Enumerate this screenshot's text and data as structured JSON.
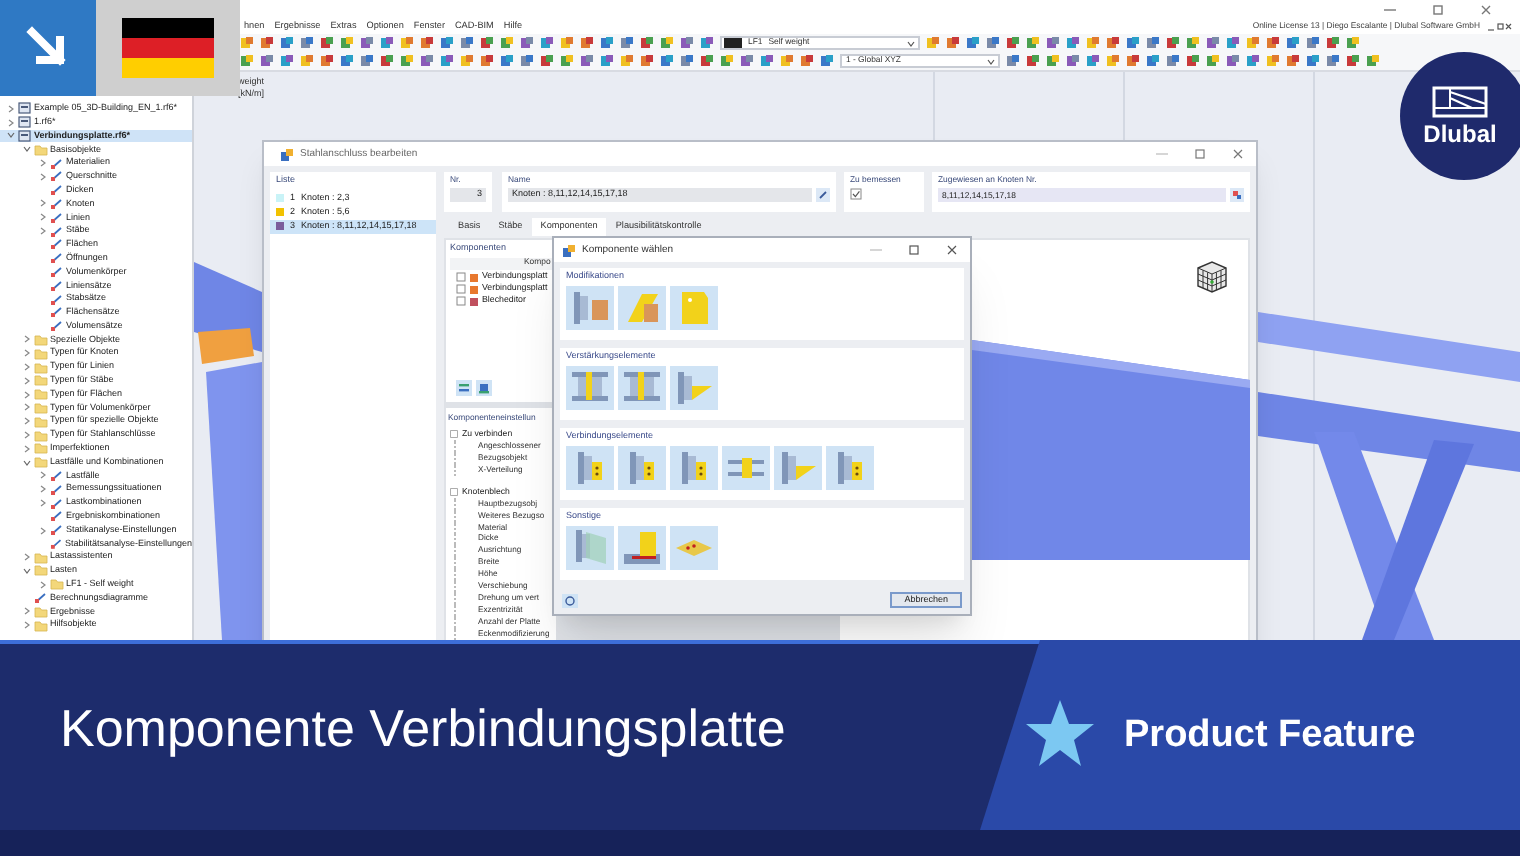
{
  "app": {
    "menu": [
      "hnen",
      "Ergebnisse",
      "Extras",
      "Optionen",
      "Fenster",
      "CAD-BIM",
      "Hilfe"
    ],
    "license": "Online License 13 | Diego Escalante | Dlubal Software GmbH",
    "load_case": {
      "code": "LF1",
      "name": "Self weight"
    },
    "coordinate_system": "1 - Global XYZ",
    "viewport_labels": [
      "weight",
      "[kN/m]"
    ]
  },
  "navigator": {
    "items": [
      {
        "kind": "file",
        "label": "Example 05_3D-Building_EN_1.rf6*",
        "selected": false,
        "expanded": false
      },
      {
        "kind": "file",
        "label": "1.rf6*",
        "selected": false,
        "expanded": false
      },
      {
        "kind": "file",
        "label": "Verbindungsplatte.rf6*",
        "selected": true,
        "expanded": true,
        "children": [
          {
            "kind": "folder",
            "label": "Basisobjekte",
            "expanded": true,
            "children": [
              {
                "kind": "object",
                "label": "Materialien",
                "expanded": false
              },
              {
                "kind": "object",
                "label": "Querschnitte",
                "expanded": false
              },
              {
                "kind": "object",
                "label": "Dicken"
              },
              {
                "kind": "object",
                "label": "Knoten",
                "expanded": false
              },
              {
                "kind": "object",
                "label": "Linien",
                "expanded": false
              },
              {
                "kind": "object",
                "label": "Stäbe",
                "expanded": false
              },
              {
                "kind": "object",
                "label": "Flächen"
              },
              {
                "kind": "object",
                "label": "Öffnungen"
              },
              {
                "kind": "object",
                "label": "Volumenkörper"
              },
              {
                "kind": "object",
                "label": "Liniensätze"
              },
              {
                "kind": "object",
                "label": "Stabsätze"
              },
              {
                "kind": "object",
                "label": "Flächensätze"
              },
              {
                "kind": "object",
                "label": "Volumensätze"
              }
            ]
          },
          {
            "kind": "folder",
            "label": "Spezielle Objekte",
            "expanded": false
          },
          {
            "kind": "folder",
            "label": "Typen für Knoten",
            "expanded": false
          },
          {
            "kind": "folder",
            "label": "Typen für Linien",
            "expanded": false
          },
          {
            "kind": "folder",
            "label": "Typen für Stäbe",
            "expanded": false
          },
          {
            "kind": "folder",
            "label": "Typen für Flächen",
            "expanded": false
          },
          {
            "kind": "folder",
            "label": "Typen für Volumenkörper",
            "expanded": false
          },
          {
            "kind": "folder",
            "label": "Typen für spezielle Objekte",
            "expanded": false
          },
          {
            "kind": "folder",
            "label": "Typen für Stahlanschlüsse",
            "expanded": false
          },
          {
            "kind": "folder",
            "label": "Imperfektionen",
            "expanded": false
          },
          {
            "kind": "folder",
            "label": "Lastfälle und Kombinationen",
            "expanded": true,
            "children": [
              {
                "kind": "object",
                "label": "Lastfälle",
                "expanded": false
              },
              {
                "kind": "object",
                "label": "Bemessungssituationen",
                "expanded": false
              },
              {
                "kind": "object",
                "label": "Lastkombinationen",
                "expanded": false
              },
              {
                "kind": "object",
                "label": "Ergebniskombinationen"
              },
              {
                "kind": "object",
                "label": "Statikanalyse-Einstellungen",
                "expanded": false
              },
              {
                "kind": "object",
                "label": "Stabilitätsanalyse-Einstellungen"
              }
            ]
          },
          {
            "kind": "folder",
            "label": "Lastassistenten",
            "expanded": false
          },
          {
            "kind": "folder",
            "label": "Lasten",
            "expanded": true,
            "children": [
              {
                "kind": "folder",
                "label": "LF1 - Self weight",
                "expanded": false
              }
            ]
          },
          {
            "kind": "object",
            "label": "Berechnungsdiagramme"
          },
          {
            "kind": "folder",
            "label": "Ergebnisse",
            "expanded": false
          },
          {
            "kind": "folder",
            "label": "Hilfsobjekte",
            "expanded": false
          }
        ]
      }
    ]
  },
  "dialog": {
    "title": "Stahlanschluss bearbeiten",
    "list": {
      "label": "Liste",
      "items": [
        {
          "number": "1",
          "text": "Knoten : 2,3",
          "color": "#c9f3f7",
          "selected": false
        },
        {
          "number": "2",
          "text": "Knoten : 5,6",
          "color": "#f2c200",
          "selected": false
        },
        {
          "number": "3",
          "text": "Knoten : 8,11,12,14,15,17,18",
          "color": "#7b5d9c",
          "selected": true
        }
      ]
    },
    "number": {
      "label": "Nr.",
      "value": "3"
    },
    "name": {
      "label": "Name",
      "value": "Knoten : 8,11,12,14,15,17,18"
    },
    "design": {
      "label": "Zu bemessen",
      "checked": true
    },
    "assigned": {
      "label": "Zugewiesen an Knoten Nr.",
      "value": "8,11,12,14,15,17,18"
    },
    "tabs": [
      {
        "label": "Basis",
        "selected": false
      },
      {
        "label": "Stäbe",
        "selected": false
      },
      {
        "label": "Komponenten",
        "selected": true
      },
      {
        "label": "Plausibilitätskontrolle",
        "selected": false
      }
    ],
    "components": {
      "title": "Komponenten",
      "column": "Kompo",
      "rows": [
        {
          "checked": false,
          "color": "#e8782e",
          "text": "Verbindungsplatt"
        },
        {
          "checked": false,
          "color": "#e8782e",
          "text": "Verbindungsplatt"
        },
        {
          "checked": false,
          "color": "#c0505e",
          "text": "Blecheditor"
        }
      ]
    },
    "settings": {
      "title": "Komponenteneinstellun",
      "groups": [
        {
          "label": "Zu verbinden",
          "checked": false,
          "children": [
            "Angeschlossener",
            "Bezugsobjekt",
            "X-Verteilung"
          ]
        },
        {
          "label": "Knotenblech",
          "checked": false,
          "children": [
            "Hauptbezugsobj",
            "Weiteres Bezugso",
            "Material",
            "Dicke",
            "Ausrichtung",
            "Breite",
            "Höhe",
            "Verschiebung",
            "Drehung um vert",
            "Exzentrizität",
            "Anzahl der Platte",
            "Eckenmodifizierung"
          ]
        }
      ]
    }
  },
  "component_dialog": {
    "title": "Komponente wählen",
    "sections": [
      {
        "title": "Modifikationen",
        "tiles": [
          {
            "kind": "box"
          },
          {
            "kind": "cut"
          },
          {
            "kind": "sheet"
          }
        ]
      },
      {
        "title": "Verstärkungselemente",
        "tiles": [
          {
            "kind": "stiffener"
          },
          {
            "kind": "stiffener"
          },
          {
            "kind": "haunch"
          }
        ]
      },
      {
        "title": "Verbindungselemente",
        "tiles": [
          {
            "kind": "plate"
          },
          {
            "kind": "plate"
          },
          {
            "kind": "plate"
          },
          {
            "kind": "splice"
          },
          {
            "kind": "haunch"
          },
          {
            "kind": "plate"
          }
        ]
      },
      {
        "title": "Sonstige",
        "tiles": [
          {
            "kind": "grid"
          },
          {
            "kind": "weld"
          },
          {
            "kind": "flat"
          }
        ]
      }
    ],
    "cancel": "Abbrechen"
  },
  "logo": {
    "text": "Dlubal"
  },
  "banner": {
    "title": "Komponente Verbindungsplatte",
    "tag": "Product Feature"
  }
}
